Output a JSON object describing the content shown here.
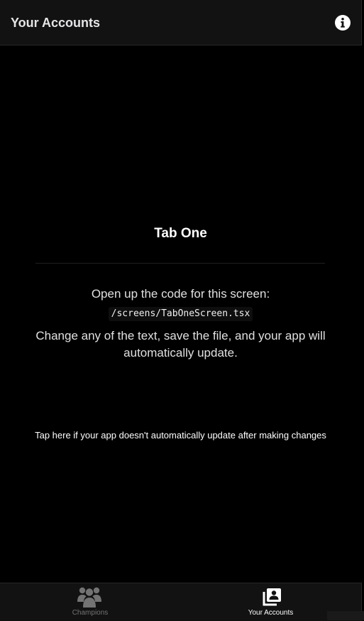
{
  "header": {
    "title": "Your Accounts",
    "info_icon": "info-circle-icon"
  },
  "main": {
    "title": "Tab One",
    "instructions_line1": "Open up the code for this screen:",
    "code_path": "/screens/TabOneScreen.tsx",
    "instructions_line2": "Change any of the text, save the file, and your app will automatically update.",
    "help_link": "Tap here if your app doesn't automatically update after making changes"
  },
  "tabbar": {
    "tabs": [
      {
        "label": "Champions",
        "icon": "users-group-icon",
        "active": false
      },
      {
        "label": "Your Accounts",
        "icon": "contacts-book-icon",
        "active": true
      }
    ]
  },
  "colors": {
    "background": "#000000",
    "bar_background": "#121212",
    "active_tab": "#ffffff",
    "inactive_tab": "#737373"
  }
}
